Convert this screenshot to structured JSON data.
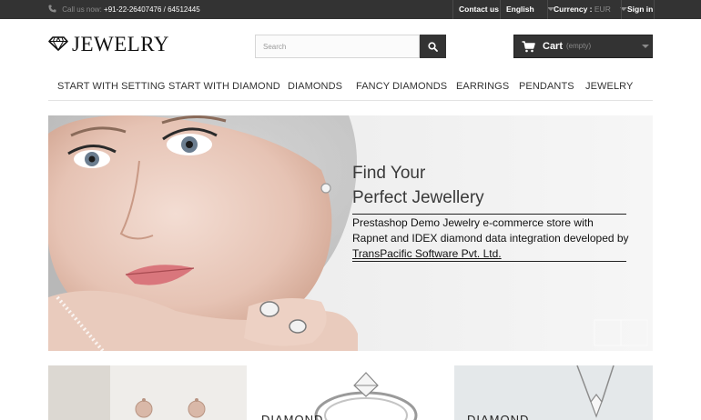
{
  "topbar": {
    "phone_prefix": "Call us now:",
    "phone_numbers": "+91-22-26407476 / 64512445",
    "contact_label": "Contact us",
    "language_label": "English",
    "currency_label": "Currency :",
    "currency_value": "EUR",
    "signin_label": "Sign in"
  },
  "header": {
    "logo_text": "JEWELRY",
    "search_placeholder": "Search",
    "cart_label": "Cart",
    "cart_status": "(empty)"
  },
  "menu": {
    "items": [
      "START WITH SETTING",
      "START WITH DIAMOND",
      "DIAMONDS",
      "FANCY DIAMONDS",
      "EARRINGS",
      "PENDANTS",
      "JEWELRY"
    ]
  },
  "banner": {
    "title_line1": "Find Your",
    "title_line2": "Perfect Jewellery",
    "description": "Prestashop Demo Jewelry e-commerce store with Rapnet and IDEX diamond data integration developed by",
    "company": "TransPacific Software Pvt. Ltd."
  },
  "tiles": [
    {
      "label": ""
    },
    {
      "label": "DIAMOND"
    },
    {
      "label": "DIAMOND"
    }
  ],
  "colors": {
    "topbar_bg": "#333333",
    "accent_dark": "#333333",
    "muted_text": "#8a8a8a"
  },
  "icons": [
    "phone-icon",
    "search-icon",
    "cart-icon",
    "diamond-logo-icon",
    "chevron-down-icon"
  ]
}
